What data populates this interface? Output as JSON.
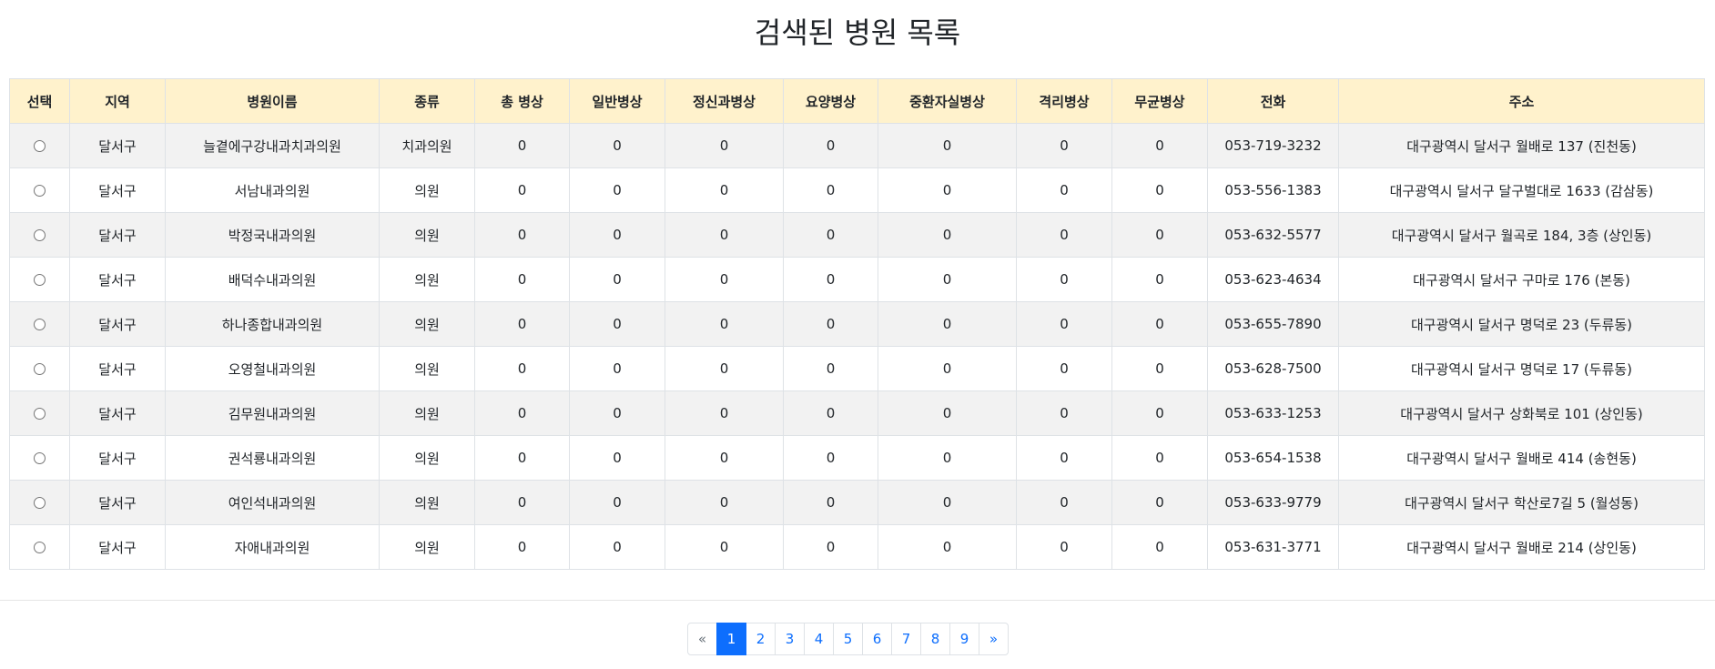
{
  "page": {
    "title": "검색된 병원 목록"
  },
  "table": {
    "headers": [
      "선택",
      "지역",
      "병원이름",
      "종류",
      "총 병상",
      "일반병상",
      "정신과병상",
      "요양병상",
      "중환자실병상",
      "격리병상",
      "무균병상",
      "전화",
      "주소"
    ],
    "rows": [
      [
        "달서구",
        "늘곁에구강내과치과의원",
        "치과의원",
        "0",
        "0",
        "0",
        "0",
        "0",
        "0",
        "0",
        "053-719-3232",
        "대구광역시 달서구 월배로 137 (진천동)"
      ],
      [
        "달서구",
        "서남내과의원",
        "의원",
        "0",
        "0",
        "0",
        "0",
        "0",
        "0",
        "0",
        "053-556-1383",
        "대구광역시 달서구 달구벌대로 1633 (감삼동)"
      ],
      [
        "달서구",
        "박정국내과의원",
        "의원",
        "0",
        "0",
        "0",
        "0",
        "0",
        "0",
        "0",
        "053-632-5577",
        "대구광역시 달서구 월곡로 184, 3층 (상인동)"
      ],
      [
        "달서구",
        "배덕수내과의원",
        "의원",
        "0",
        "0",
        "0",
        "0",
        "0",
        "0",
        "0",
        "053-623-4634",
        "대구광역시 달서구 구마로 176 (본동)"
      ],
      [
        "달서구",
        "하나종합내과의원",
        "의원",
        "0",
        "0",
        "0",
        "0",
        "0",
        "0",
        "0",
        "053-655-7890",
        "대구광역시 달서구 명덕로 23 (두류동)"
      ],
      [
        "달서구",
        "오영철내과의원",
        "의원",
        "0",
        "0",
        "0",
        "0",
        "0",
        "0",
        "0",
        "053-628-7500",
        "대구광역시 달서구 명덕로 17 (두류동)"
      ],
      [
        "달서구",
        "김무원내과의원",
        "의원",
        "0",
        "0",
        "0",
        "0",
        "0",
        "0",
        "0",
        "053-633-1253",
        "대구광역시 달서구 상화북로 101 (상인동)"
      ],
      [
        "달서구",
        "권석룡내과의원",
        "의원",
        "0",
        "0",
        "0",
        "0",
        "0",
        "0",
        "0",
        "053-654-1538",
        "대구광역시 달서구 월배로 414 (송현동)"
      ],
      [
        "달서구",
        "여인석내과의원",
        "의원",
        "0",
        "0",
        "0",
        "0",
        "0",
        "0",
        "0",
        "053-633-9779",
        "대구광역시 달서구 학산로7길 5 (월성동)"
      ],
      [
        "달서구",
        "자애내과의원",
        "의원",
        "0",
        "0",
        "0",
        "0",
        "0",
        "0",
        "0",
        "053-631-3771",
        "대구광역시 달서구 월배로 214 (상인동)"
      ]
    ]
  },
  "pagination": {
    "prev": "«",
    "next": "»",
    "pages": [
      "1",
      "2",
      "3",
      "4",
      "5",
      "6",
      "7",
      "8",
      "9"
    ],
    "current": "1"
  },
  "colors": {
    "header_bg": "#fff2cc",
    "stripe_bg": "#f2f2f2",
    "accent": "#0d6efd"
  }
}
